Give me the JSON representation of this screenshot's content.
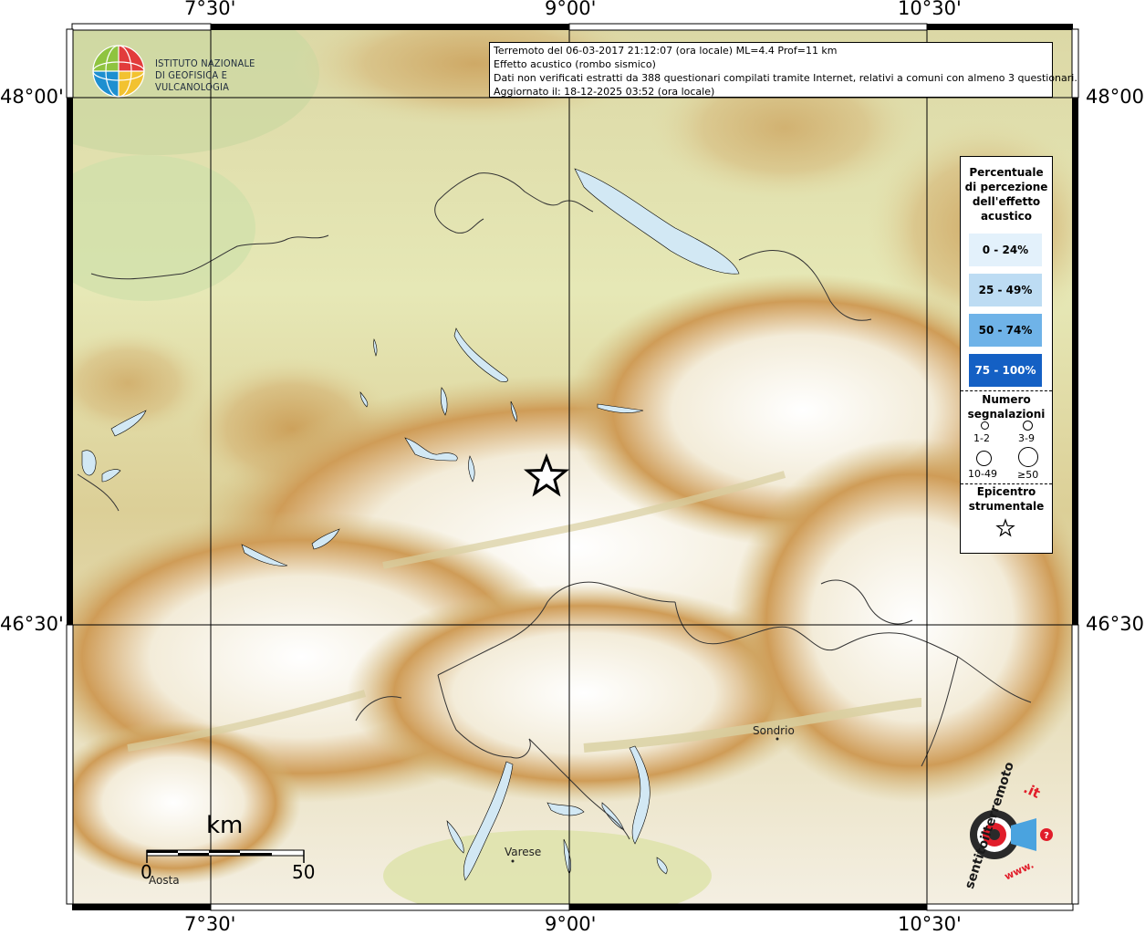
{
  "map": {
    "lon_labels": [
      "7°30'",
      "9°00'",
      "10°30'"
    ],
    "lat_labels": [
      "48°00'",
      "46°30'"
    ],
    "colors": {
      "lowland": "#e8ebb8",
      "hills": "#d9c98e",
      "mountain": "#c8944a",
      "high": "#ffffff",
      "water": "#d2e8f4",
      "grid": "#000000",
      "border": "#333333"
    }
  },
  "header": {
    "line1": "Terremoto del 06-03-2017 21:12:07 (ora locale) ML=4.4 Prof=11 km",
    "line2": "Effetto acustico (rombo sismico)",
    "line3": "Dati non verificati estratti da 388 questionari compilati tramite Internet, relativi a comuni con almeno 3 questionari.",
    "line4": "Aggiornato il: 18-12-2025 03:52 (ora locale)"
  },
  "logo": {
    "line1": "ISTITUTO NAZIONALE",
    "line2": "DI GEOFISICA E VULCANOLOGIA",
    "icon": "ingv-globe-icon"
  },
  "legend": {
    "title_lines": [
      "Percentuale",
      "di percezione",
      "dell'effetto",
      "acustico"
    ],
    "classes": [
      {
        "label": "0 - 24%",
        "color": "#e3f1fb"
      },
      {
        "label": "25 - 49%",
        "color": "#bddcf3"
      },
      {
        "label": "50 - 74%",
        "color": "#6fb3e8"
      },
      {
        "label": "75 - 100%",
        "color": "#1460c4"
      }
    ],
    "count_title_lines": [
      "Numero",
      "segnalazioni"
    ],
    "counts": [
      "1-2",
      "3-9",
      "10-49",
      "≥50"
    ],
    "epicenter_title_lines": [
      "Epicentro",
      "strumentale"
    ],
    "epicenter_icon": "star-icon"
  },
  "places": [
    {
      "name": "Sondrio"
    },
    {
      "name": "Varese"
    },
    {
      "name": "Aosta"
    }
  ],
  "scale": {
    "unit": "km",
    "start": "0",
    "end": "50"
  },
  "badge": {
    "text_main": "sentitoilterremoto",
    "text_suffix": ".it",
    "text_bottom": "www.",
    "icon": "megaphone-icon"
  }
}
